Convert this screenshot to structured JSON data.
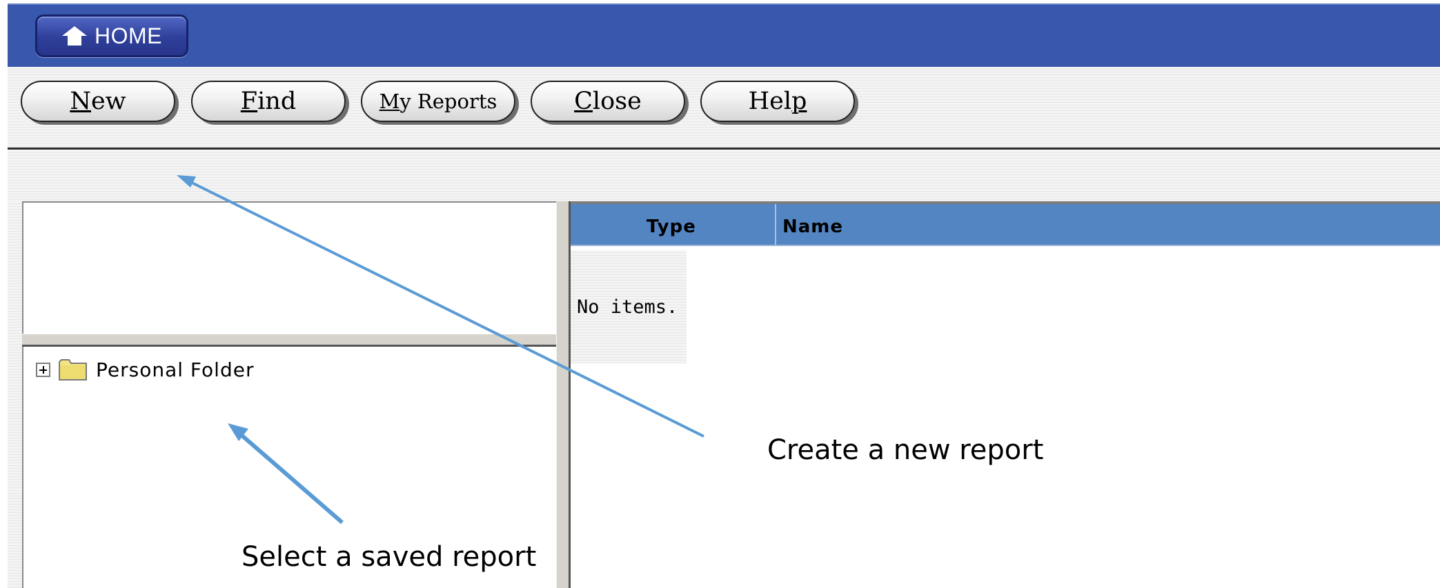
{
  "topbar": {
    "home_label": "HOME",
    "home_icon": "home-arrow-icon",
    "background": "#3758ad"
  },
  "toolbar": {
    "buttons": [
      {
        "id": "new",
        "label": "New",
        "mnemonic": "N"
      },
      {
        "id": "find",
        "label": "Find",
        "mnemonic": "F"
      },
      {
        "id": "my_reports",
        "label": "My Reports",
        "mnemonic": "M"
      },
      {
        "id": "close",
        "label": "Close",
        "mnemonic": "C"
      },
      {
        "id": "help",
        "label": "Help",
        "mnemonic": "p"
      }
    ]
  },
  "tree": {
    "items": [
      {
        "label": "Personal Folder",
        "icon": "folder-icon",
        "expander": "plus"
      }
    ]
  },
  "list": {
    "columns": [
      "Type",
      "Name"
    ],
    "empty_message": "No items.",
    "header_color": "#5485c3"
  },
  "annotations": {
    "create_new": "Create a new report",
    "select_saved": "Select a saved report",
    "arrow_color": "#5b9bd5"
  }
}
